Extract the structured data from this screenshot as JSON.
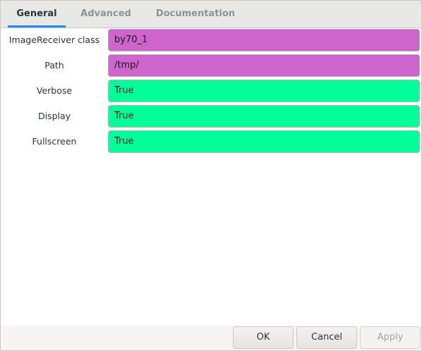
{
  "tabs": [
    {
      "label": "General",
      "active": true
    },
    {
      "label": "Advanced",
      "active": false
    },
    {
      "label": "Documentation",
      "active": false
    }
  ],
  "params": [
    {
      "label": "ImageReceiver class",
      "value": "by70_1",
      "kind": "string"
    },
    {
      "label": "Path",
      "value": "/tmp/",
      "kind": "string"
    },
    {
      "label": "Verbose",
      "value": "True",
      "kind": "bool"
    },
    {
      "label": "Display",
      "value": "True",
      "kind": "bool"
    },
    {
      "label": "Fullscreen",
      "value": "True",
      "kind": "bool"
    }
  ],
  "buttons": {
    "ok": "OK",
    "cancel": "Cancel",
    "apply": "Apply"
  },
  "colors": {
    "string_field": "#cc66cc",
    "bool_field": "#00ff99",
    "active_tab_underline": "#3584e4"
  }
}
